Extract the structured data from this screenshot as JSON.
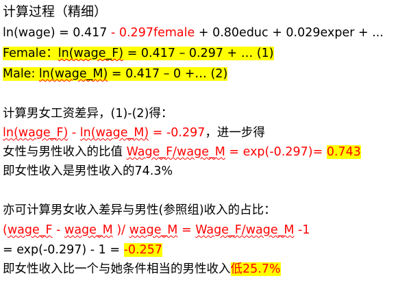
{
  "title": "计算过程（精细）",
  "model": {
    "lhs": "ln(wage) = 0.417 ",
    "female_term": "- 0.297female",
    "rest": " + 0.80educ + 0.029exper + ..."
  },
  "female_eq": {
    "prefix": "Female：",
    "lhs": "ln(wage_F)",
    "rhs": " = 0.417 – 0.297 + …    (1)"
  },
  "male_eq": {
    "prefix": "Male: ",
    "lhs": "ln(wage_M)",
    "rhs": "  = 0.417 – 0 +…    (2)"
  },
  "diff_intro": "计算男女工资差异，(1)-(2)得：",
  "diff_line": {
    "term1": "ln(wage_F)",
    "minus": " - ",
    "term2": "ln(wage_M)",
    "result": " = -0.297",
    "tail": "，进一步得"
  },
  "ratio_line": {
    "prefix": "女性与男性收入的比值 ",
    "expr": "Wage_F/wage_M",
    "expr_tail": " = exp(-0.297)= ",
    "value": "0.743"
  },
  "ratio_conclusion": "即女性收入是男性收入的74.3%",
  "share_intro": "亦可计算男女收入差异与男性(参照组)收入的占比：",
  "share_formula": {
    "open": "(",
    "t1": "wage_F",
    "minus": " - ",
    "t2": "wage_M",
    "mid": " )/ ",
    "t3": "wage_M",
    "eq": " = ",
    "t4": "Wage_F/wage_M",
    "tail": " -1"
  },
  "share_result": {
    "prefix": "= exp(-0.297) - 1 = ",
    "value": "-0.257"
  },
  "share_conclusion": {
    "prefix": "即女性收入比一个与她条件相当的男性收入",
    "value": "低25.7%"
  }
}
